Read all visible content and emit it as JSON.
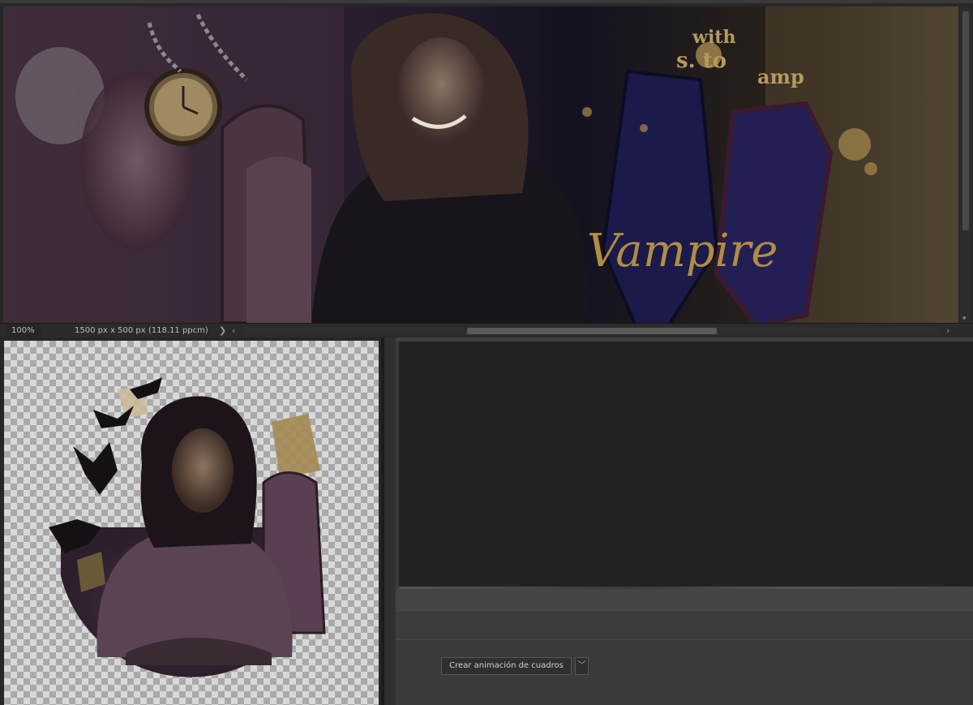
{
  "top_document": {
    "artwork_text": "Vampire",
    "background_text_fragments": [
      "with",
      "s. to",
      "amp"
    ],
    "status": {
      "zoom": "100%",
      "doc_size": "1500 px x 500 px (118.11 ppcm)",
      "more_arrow": "❯",
      "scroll_left": "‹",
      "scroll_right": "›"
    }
  },
  "bottom_document": {
    "description_icon": "portrait-cutout"
  },
  "timeline_panel": {
    "create_button_label": "Crear animación de cuadros",
    "dropdown_glyph": "﹀"
  },
  "colors": {
    "app_background": "#1e1e1e",
    "panel": "#3a3a3a",
    "timeline_area": "#232323",
    "art_gold": "#b08d45",
    "art_navy": "#1c1a4a",
    "art_plum": "#3a2236"
  }
}
